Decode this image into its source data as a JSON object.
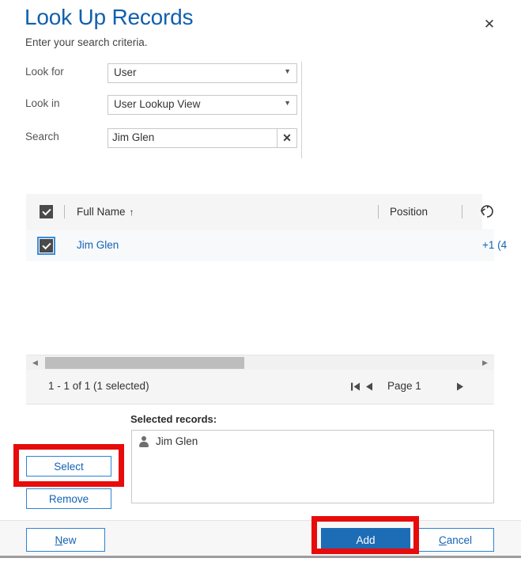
{
  "dialog": {
    "title": "Look Up Records",
    "subtitle": "Enter your search criteria.",
    "close_label": "✕",
    "accent_color": "#1060ad",
    "primary_button_color": "#1d6cb6",
    "annotation_color": "#e70b0b"
  },
  "criteria": {
    "look_for": {
      "label": "Look for",
      "value": "User",
      "caret": "▼"
    },
    "look_in": {
      "label": "Look in",
      "value": "User Lookup View",
      "caret": "▼"
    },
    "search": {
      "label": "Search",
      "value": "Jim Glen",
      "placeholder": "",
      "clear_label": "✕"
    }
  },
  "grid": {
    "columns": [
      {
        "label": "Full Name",
        "sort": "↑"
      },
      {
        "label": "Position",
        "sort": ""
      }
    ],
    "refresh_icon": "refresh-icon",
    "rows": [
      {
        "full_name": "Jim Glen",
        "phone": "+1 (4",
        "checked": true
      }
    ],
    "header_checked": true,
    "pager": {
      "count_text": "1 - 1 of 1 (1 selected)",
      "page_label": "Page 1",
      "first_icon": "◀",
      "prev_icon": "◀",
      "next_icon": "▶"
    },
    "scrollbar": {
      "left_arrow": "◀",
      "right_arrow": "▶"
    }
  },
  "selected": {
    "label": "Selected records:",
    "items": [
      {
        "name": "Jim Glen",
        "icon": "person-icon"
      }
    ],
    "select_button": "Select",
    "remove_button": "Remove"
  },
  "footer": {
    "new_button": {
      "prefix": "",
      "accel": "N",
      "suffix": "ew"
    },
    "add_button": "Add",
    "cancel_button": {
      "prefix": "",
      "accel": "C",
      "suffix": "ancel"
    }
  }
}
